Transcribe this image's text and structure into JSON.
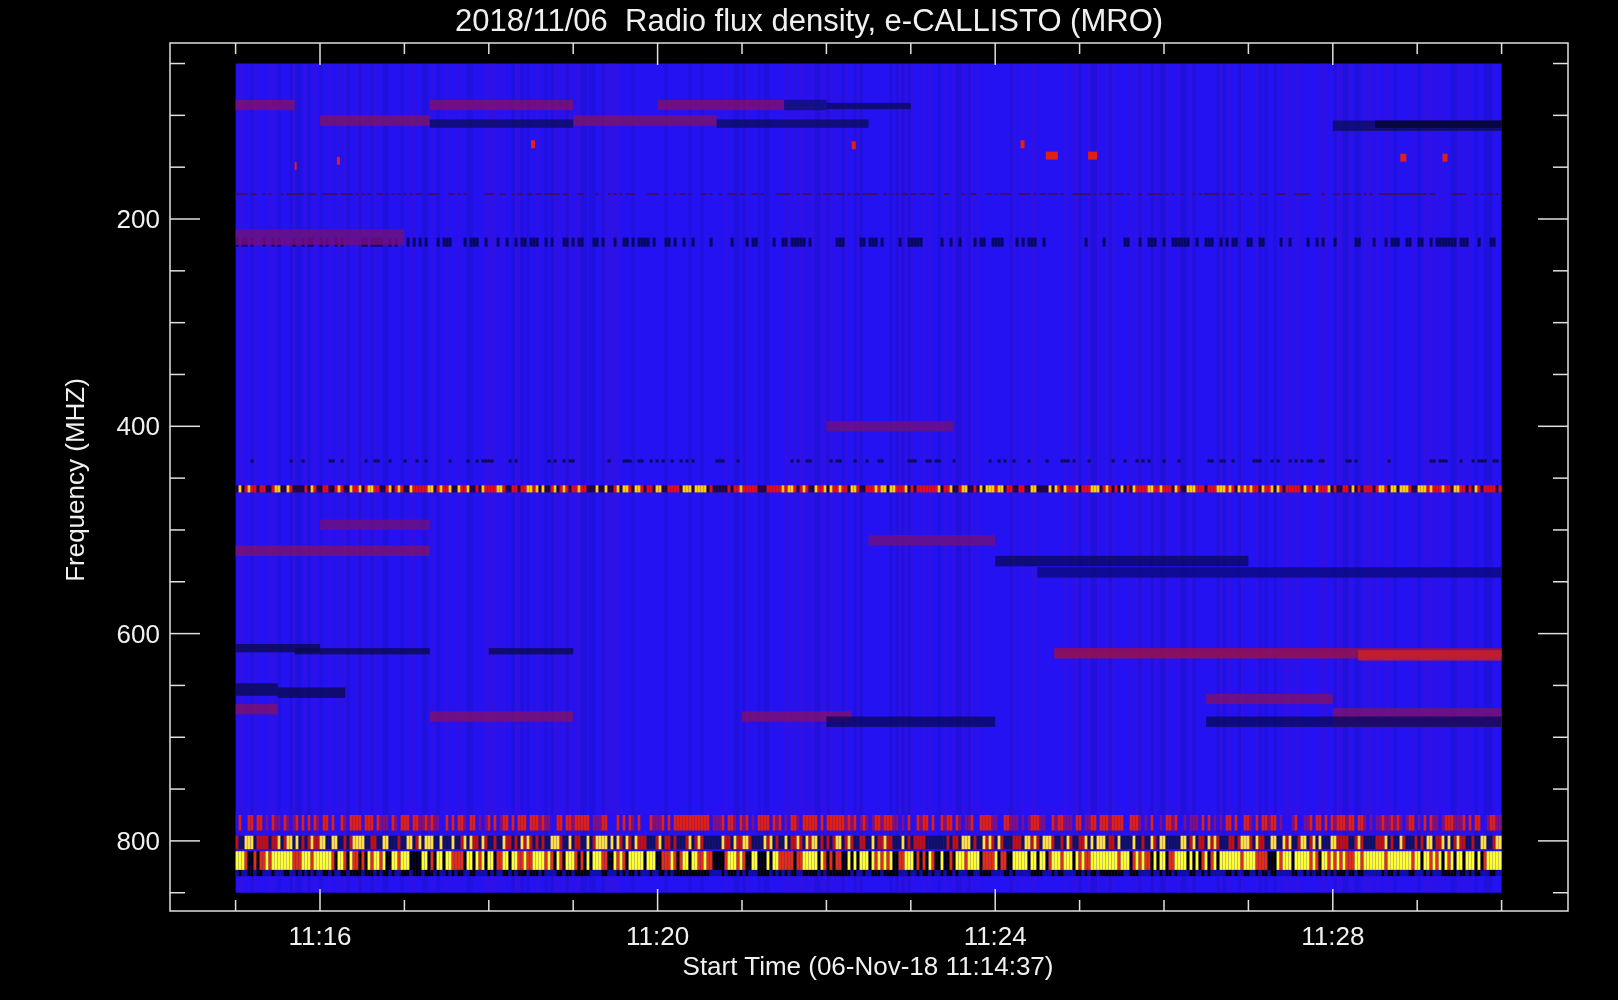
{
  "chart": {
    "title": "2018/11/06  Radio flux density, e-CALLISTO (MRO)",
    "y_axis": {
      "label": "Frequency (MHZ)",
      "tick_labels": [
        "200",
        "400",
        "600",
        "800"
      ]
    },
    "x_axis": {
      "label": "Start Time (06-Nov-18 11:14:37)",
      "tick_labels": [
        "11:16",
        "11:20",
        "11:24",
        "11:28"
      ]
    }
  }
}
